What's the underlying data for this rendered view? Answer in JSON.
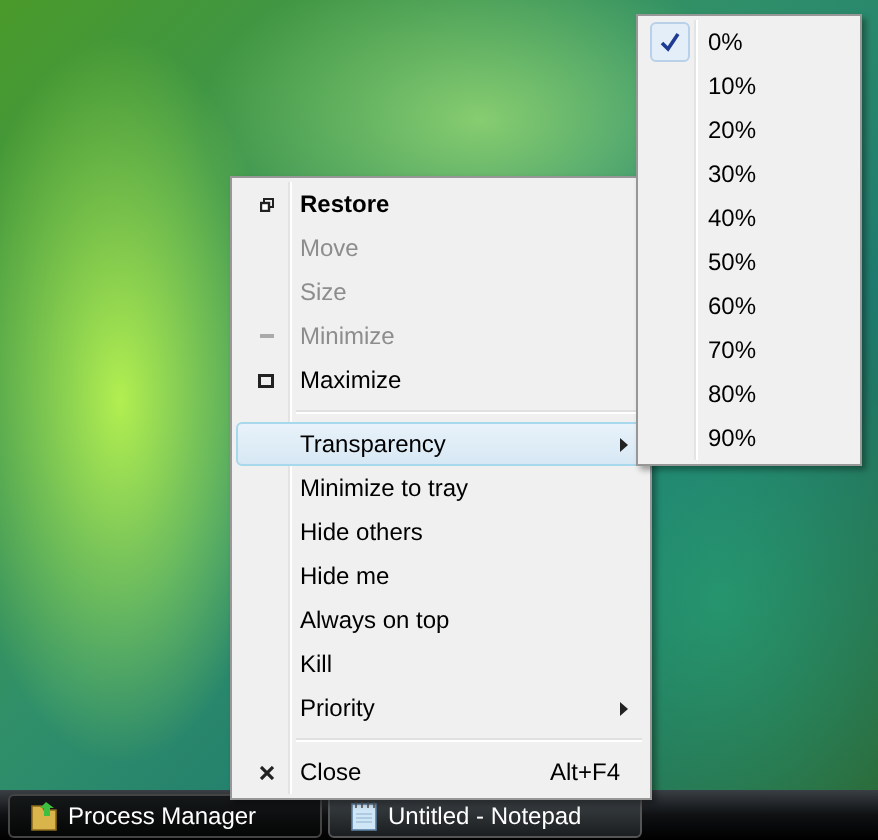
{
  "menu": {
    "items": [
      {
        "kind": "restore",
        "label": "Restore",
        "default": true,
        "disabled": false,
        "selected": false
      },
      {
        "kind": "move",
        "label": "Move",
        "default": false,
        "disabled": true,
        "selected": false
      },
      {
        "kind": "size",
        "label": "Size",
        "default": false,
        "disabled": true,
        "selected": false
      },
      {
        "kind": "minimize",
        "label": "Minimize",
        "default": false,
        "disabled": true,
        "selected": false
      },
      {
        "kind": "maximize",
        "label": "Maximize",
        "default": false,
        "disabled": false,
        "selected": false
      },
      {
        "kind": "separator"
      },
      {
        "kind": "submenu",
        "label": "Transparency",
        "default": false,
        "disabled": false,
        "selected": true
      },
      {
        "kind": "plain",
        "label": "Minimize to tray",
        "default": false,
        "disabled": false,
        "selected": false
      },
      {
        "kind": "plain",
        "label": "Hide others",
        "default": false,
        "disabled": false,
        "selected": false
      },
      {
        "kind": "plain",
        "label": "Hide me",
        "default": false,
        "disabled": false,
        "selected": false
      },
      {
        "kind": "plain",
        "label": "Always on top",
        "default": false,
        "disabled": false,
        "selected": false
      },
      {
        "kind": "plain",
        "label": "Kill",
        "default": false,
        "disabled": false,
        "selected": false
      },
      {
        "kind": "submenu",
        "label": "Priority",
        "default": false,
        "disabled": false,
        "selected": false
      },
      {
        "kind": "separator"
      },
      {
        "kind": "close",
        "label": "Close",
        "shortcut": "Alt+F4",
        "default": false,
        "disabled": false,
        "selected": false
      }
    ]
  },
  "submenu": {
    "items": [
      {
        "label": "0%",
        "checked": true
      },
      {
        "label": "10%",
        "checked": false
      },
      {
        "label": "20%",
        "checked": false
      },
      {
        "label": "30%",
        "checked": false
      },
      {
        "label": "40%",
        "checked": false
      },
      {
        "label": "50%",
        "checked": false
      },
      {
        "label": "60%",
        "checked": false
      },
      {
        "label": "70%",
        "checked": false
      },
      {
        "label": "80%",
        "checked": false
      },
      {
        "label": "90%",
        "checked": false
      }
    ]
  },
  "taskbar": {
    "buttons": [
      {
        "kind": "folder",
        "label": "Process Manager",
        "selected": true
      },
      {
        "kind": "notepad",
        "label": "Untitled - Notepad",
        "selected": false
      }
    ]
  }
}
